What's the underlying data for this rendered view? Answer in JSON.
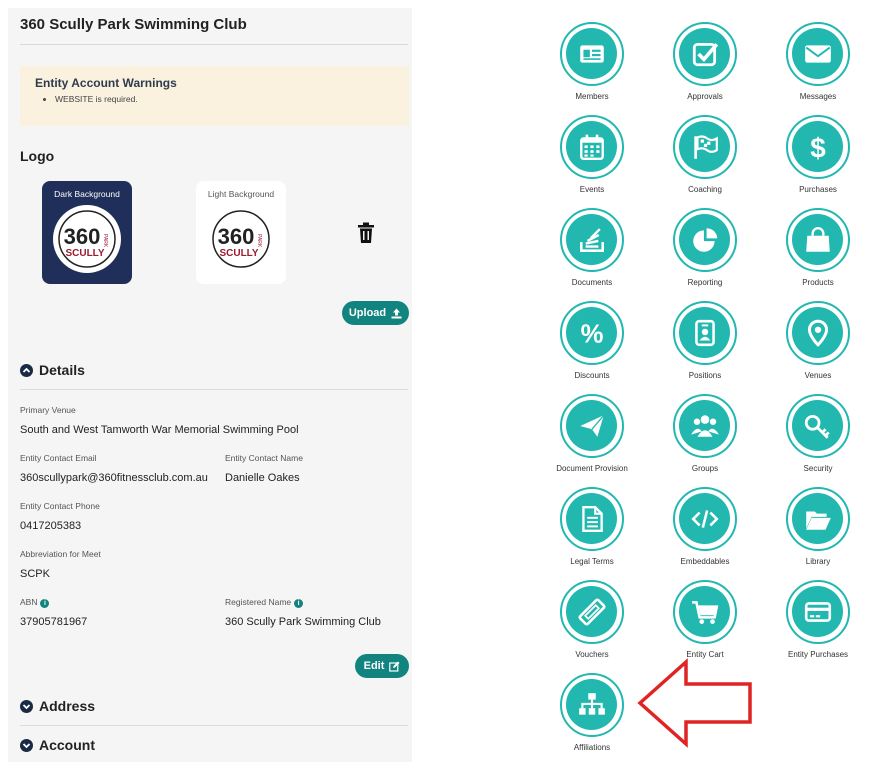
{
  "club": {
    "name": "360 Scully Park Swimming Club"
  },
  "warnings": {
    "title": "Entity Account Warnings",
    "items": [
      "WEBSITE is required."
    ]
  },
  "logo": {
    "heading": "Logo",
    "dark_caption": "Dark Background",
    "light_caption": "Light Background",
    "logo_mark_text": "360 PARK SCULLY",
    "upload_label": "Upload"
  },
  "details": {
    "heading": "Details",
    "primary_venue_label": "Primary Venue",
    "primary_venue": "South and West Tamworth War Memorial Swimming Pool",
    "email_label": "Entity Contact Email",
    "email": "360scullypark@360fitnessclub.com.au",
    "contact_name_label": "Entity Contact Name",
    "contact_name": "Danielle Oakes",
    "phone_label": "Entity Contact Phone",
    "phone": "0417205383",
    "abbr_label": "Abbreviation for Meet",
    "abbr": "SCPK",
    "abn_label": "ABN",
    "abn": "37905781967",
    "registered_label": "Registered Name",
    "registered": "360 Scully Park Swimming Club",
    "edit_label": "Edit"
  },
  "sections": {
    "address": "Address",
    "account": "Account"
  },
  "info_glyph": "i",
  "tiles": [
    {
      "label": "Members",
      "icon": "id-card-icon"
    },
    {
      "label": "Approvals",
      "icon": "checkbox-icon"
    },
    {
      "label": "Messages",
      "icon": "envelope-icon"
    },
    {
      "label": "Events",
      "icon": "calendar-icon"
    },
    {
      "label": "Coaching",
      "icon": "flag-icon"
    },
    {
      "label": "Purchases",
      "icon": "dollar-icon"
    },
    {
      "label": "Documents",
      "icon": "stack-icon"
    },
    {
      "label": "Reporting",
      "icon": "pie-chart-icon"
    },
    {
      "label": "Products",
      "icon": "shopping-bag-icon"
    },
    {
      "label": "Discounts",
      "icon": "percent-icon"
    },
    {
      "label": "Positions",
      "icon": "badge-icon"
    },
    {
      "label": "Venues",
      "icon": "map-pin-icon"
    },
    {
      "label": "Document Provision",
      "icon": "paper-plane-icon"
    },
    {
      "label": "Groups",
      "icon": "users-icon"
    },
    {
      "label": "Security",
      "icon": "key-icon"
    },
    {
      "label": "Legal Terms",
      "icon": "file-text-icon"
    },
    {
      "label": "Embeddables",
      "icon": "code-icon"
    },
    {
      "label": "Library",
      "icon": "folder-open-icon"
    },
    {
      "label": "Vouchers",
      "icon": "ticket-icon"
    },
    {
      "label": "Entity Cart",
      "icon": "cart-icon"
    },
    {
      "label": "Entity Purchases",
      "icon": "credit-card-icon"
    },
    {
      "label": "Affiliations",
      "icon": "sitemap-icon"
    }
  ],
  "colors": {
    "teal": "#22b8b0",
    "button": "#11847f",
    "navy": "#1f2f5a",
    "warning_bg": "#faf1df",
    "arrow": "#e02424"
  }
}
